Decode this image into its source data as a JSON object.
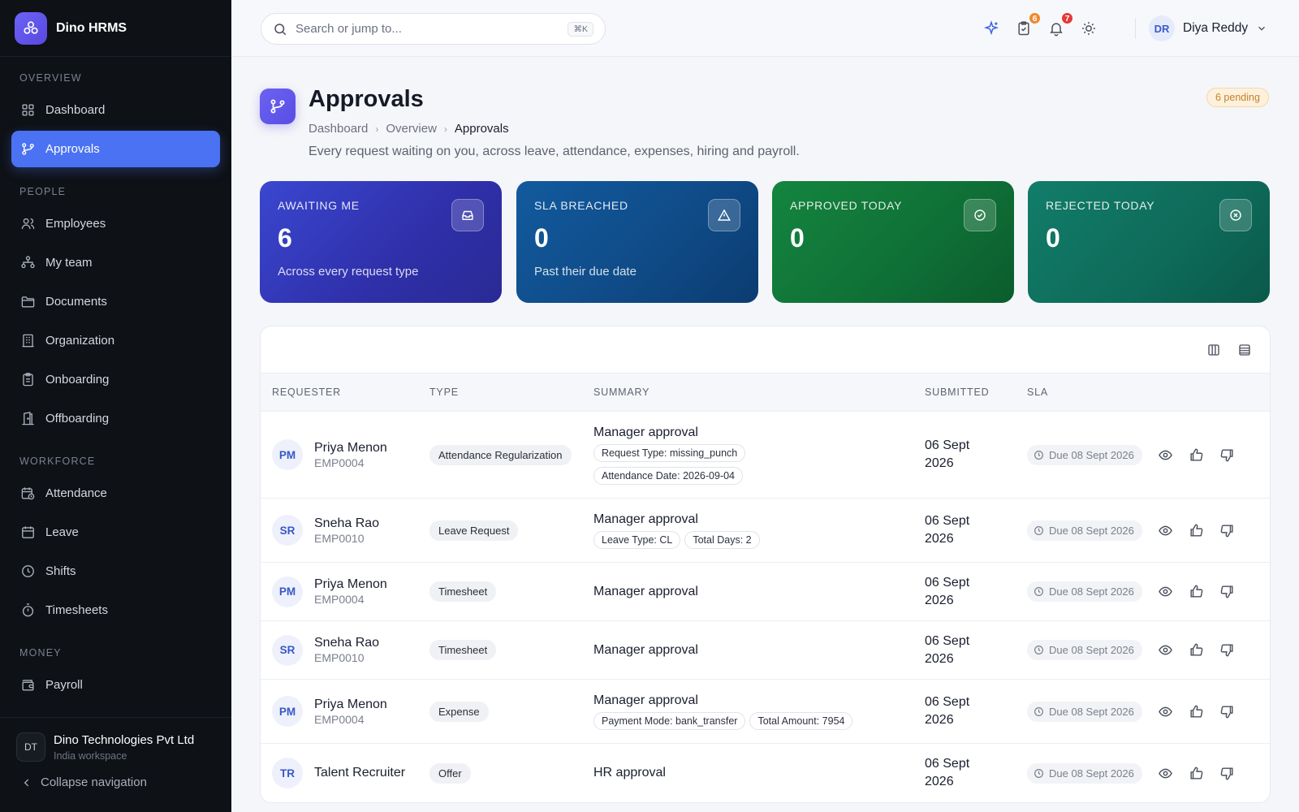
{
  "brand": {
    "name": "Dino HRMS"
  },
  "sidebar": {
    "sections": [
      {
        "title": "OVERVIEW"
      },
      {
        "title": "PEOPLE"
      },
      {
        "title": "WORKFORCE"
      },
      {
        "title": "MONEY"
      }
    ],
    "items": [
      {
        "label": "Dashboard",
        "icon": "grid-icon"
      },
      {
        "label": "Approvals",
        "icon": "git-branch-icon",
        "active": true
      },
      {
        "label": "Employees",
        "icon": "users-icon"
      },
      {
        "label": "My team",
        "icon": "team-icon"
      },
      {
        "label": "Documents",
        "icon": "folder-icon"
      },
      {
        "label": "Organization",
        "icon": "building-icon"
      },
      {
        "label": "Onboarding",
        "icon": "clipboard-icon"
      },
      {
        "label": "Offboarding",
        "icon": "door-icon"
      },
      {
        "label": "Attendance",
        "icon": "calendar-clock-icon"
      },
      {
        "label": "Leave",
        "icon": "calendar-icon"
      },
      {
        "label": "Shifts",
        "icon": "clock-icon"
      },
      {
        "label": "Timesheets",
        "icon": "timer-icon"
      },
      {
        "label": "Payroll",
        "icon": "wallet-icon"
      }
    ],
    "org": {
      "initials": "DT",
      "name": "Dino Technologies Pvt Ltd",
      "sub": "India workspace"
    },
    "collapse_label": "Collapse navigation"
  },
  "topbar": {
    "search_placeholder": "Search or jump to...",
    "search_shortcut": "⌘K",
    "tasks_count": "6",
    "notifications_count": "7",
    "user": {
      "initials": "DR",
      "name": "Diya Reddy"
    }
  },
  "page": {
    "title": "Approvals",
    "breadcrumb": [
      "Dashboard",
      "Overview",
      "Approvals"
    ],
    "description": "Every request waiting on you, across leave, attendance, expenses, hiring and payroll.",
    "pending_label": "6 pending"
  },
  "cards": [
    {
      "label": "AWAITING ME",
      "value": "6",
      "sub": "Across every request type",
      "icon": "inbox-icon"
    },
    {
      "label": "SLA BREACHED",
      "value": "0",
      "sub": "Past their due date",
      "icon": "warning-icon"
    },
    {
      "label": "APPROVED TODAY",
      "value": "0",
      "sub": "",
      "icon": "check-circle-icon"
    },
    {
      "label": "REJECTED TODAY",
      "value": "0",
      "sub": "",
      "icon": "x-circle-icon"
    }
  ],
  "table": {
    "columns": [
      "REQUESTER",
      "TYPE",
      "SUMMARY",
      "SUBMITTED",
      "SLA"
    ],
    "rows": [
      {
        "initials": "PM",
        "name": "Priya Menon",
        "emp_id": "EMP0004",
        "type": "Attendance Regularization",
        "summary": "Manager approval",
        "chips": [
          "Request Type: missing_punch",
          "Attendance Date: 2026-09-04"
        ],
        "submitted_line1": "06 Sept",
        "submitted_line2": "2026",
        "sla": "Due 08 Sept 2026"
      },
      {
        "initials": "SR",
        "name": "Sneha Rao",
        "emp_id": "EMP0010",
        "type": "Leave Request",
        "summary": "Manager approval",
        "chips": [
          "Leave Type: CL",
          "Total Days: 2"
        ],
        "submitted_line1": "06 Sept",
        "submitted_line2": "2026",
        "sla": "Due 08 Sept 2026"
      },
      {
        "initials": "PM",
        "name": "Priya Menon",
        "emp_id": "EMP0004",
        "type": "Timesheet",
        "summary": "Manager approval",
        "chips": [],
        "submitted_line1": "06 Sept",
        "submitted_line2": "2026",
        "sla": "Due 08 Sept 2026"
      },
      {
        "initials": "SR",
        "name": "Sneha Rao",
        "emp_id": "EMP0010",
        "type": "Timesheet",
        "summary": "Manager approval",
        "chips": [],
        "submitted_line1": "06 Sept",
        "submitted_line2": "2026",
        "sla": "Due 08 Sept 2026"
      },
      {
        "initials": "PM",
        "name": "Priya Menon",
        "emp_id": "EMP0004",
        "type": "Expense",
        "summary": "Manager approval",
        "chips": [
          "Payment Mode: bank_transfer",
          "Total Amount: 7954"
        ],
        "submitted_line1": "06 Sept",
        "submitted_line2": "2026",
        "sla": "Due 08 Sept 2026"
      },
      {
        "initials": "TR",
        "name": "Talent Recruiter",
        "emp_id": "",
        "type": "Offer",
        "summary": "HR approval",
        "chips": [],
        "submitted_line1": "06 Sept",
        "submitted_line2": "2026",
        "sla": "Due 08 Sept 2026"
      }
    ]
  },
  "colors": {
    "accent": "#4a72f2",
    "sidebar_bg": "#0e1116",
    "card_awaiting": "#3b3fc9",
    "card_sla": "#0f4e8a",
    "card_approved": "#117a3d",
    "card_rejected": "#0e7260",
    "tasks_badge": "#f0892b",
    "notifications_badge": "#e53935"
  }
}
